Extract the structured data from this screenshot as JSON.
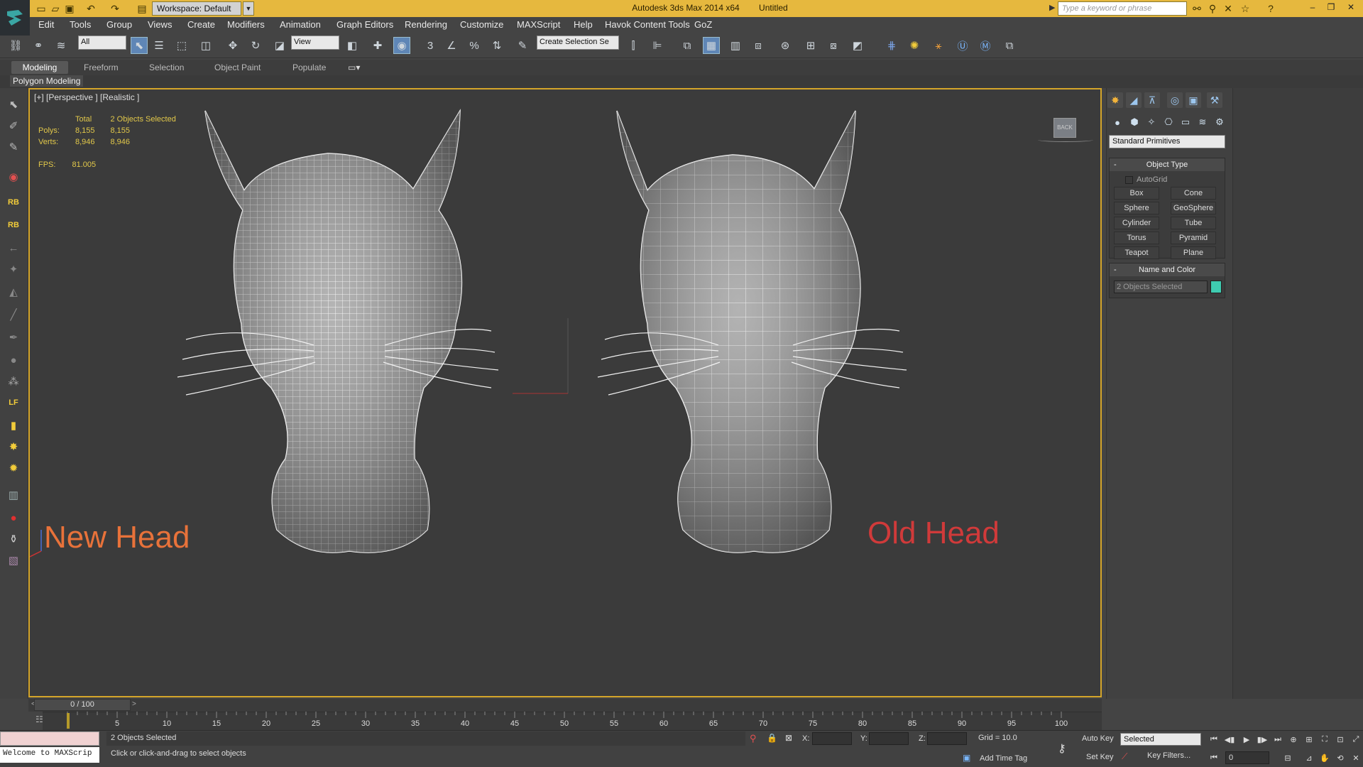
{
  "titlebar": {
    "workspace": "Workspace: Default",
    "app_title": "Autodesk 3ds Max  2014 x64",
    "doc_title": "Untitled",
    "search_placeholder": "Type a keyword or phrase"
  },
  "menu": [
    "Edit",
    "Tools",
    "Group",
    "Views",
    "Create",
    "Modifiers",
    "Animation",
    "Graph Editors",
    "Rendering",
    "Customize",
    "MAXScript",
    "Help",
    "Havok Content Tools",
    "GoZ"
  ],
  "toolbar": {
    "selection_filter": "All",
    "reference_coord": "View",
    "named_selection": "Create Selection Se"
  },
  "ribbon": {
    "tabs": [
      "Modeling",
      "Freeform",
      "Selection",
      "Object Paint",
      "Populate"
    ],
    "panel": "Polygon Modeling"
  },
  "viewport": {
    "label": "[+] [Perspective ] [Realistic ]",
    "stats": {
      "total_label": "Total",
      "selected_label": "2 Objects Selected",
      "polys_label": "Polys:",
      "polys_total": "8,155",
      "polys_selected": "8,155",
      "verts_label": "Verts:",
      "verts_total": "8,946",
      "verts_selected": "8,946",
      "fps_label": "FPS:",
      "fps_value": "81.005"
    },
    "label_new": "New Head",
    "label_old": "Old Head",
    "viewcube_face": "BACK"
  },
  "command_panel": {
    "category": "Standard Primitives",
    "object_type_title": "Object Type",
    "autogrid": "AutoGrid",
    "primitives": [
      "Box",
      "Cone",
      "Sphere",
      "GeoSphere",
      "Cylinder",
      "Tube",
      "Torus",
      "Pyramid",
      "Teapot",
      "Plane"
    ],
    "name_color_title": "Name and Color",
    "name_value": "2 Objects Selected",
    "swatch_color": "#3fcbb0"
  },
  "timeline": {
    "frame_display": "0 / 100",
    "ticks": [
      "5",
      "10",
      "15",
      "20",
      "25",
      "30",
      "35",
      "40",
      "45",
      "50",
      "55",
      "60",
      "65",
      "70",
      "75",
      "80",
      "85",
      "90",
      "95",
      "100"
    ]
  },
  "status": {
    "maxscript_welcome": "Welcome to MAXScrip",
    "selection_text": "2 Objects Selected",
    "prompt": "Click or click-and-drag to select objects",
    "x_label": "X:",
    "y_label": "Y:",
    "z_label": "Z:",
    "grid": "Grid = 10.0",
    "add_time_tag": "Add Time Tag",
    "auto_key": "Auto Key",
    "set_key": "Set Key",
    "key_mode": "Selected",
    "key_filters": "Key Filters...",
    "current_frame": "0"
  },
  "colors": {
    "titlebar": "#e6b83e",
    "viewport_border": "#d4a52a",
    "new_label": "#e8723a",
    "old_label": "#d03a3a"
  }
}
